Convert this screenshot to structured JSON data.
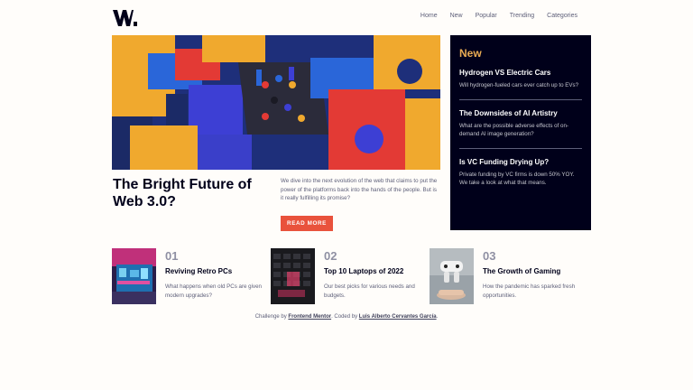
{
  "brand": {
    "logo_alt": "W."
  },
  "nav": {
    "items": [
      "Home",
      "New",
      "Popular",
      "Trending",
      "Categories"
    ]
  },
  "hero": {
    "title": "The Bright Future of Web 3.0?",
    "description": "We dive into the next evolution of the web that claims to put the power of the platforms back into the hands of the people. But is it really fulfilling its promise?",
    "button_label": "READ MORE"
  },
  "new_section": {
    "heading": "New",
    "items": [
      {
        "title": "Hydrogen VS Electric Cars",
        "description": "Will hydrogen-fueled cars ever catch up to EVs?"
      },
      {
        "title": "The Downsides of AI Artistry",
        "description": "What are the possible adverse effects of on-demand AI image generation?"
      },
      {
        "title": "Is VC Funding Drying Up?",
        "description": "Private funding by VC firms is down 50% YOY. We take a look at what that means."
      }
    ]
  },
  "cards": [
    {
      "number": "01",
      "title": "Reviving Retro PCs",
      "description": "What happens when old PCs are given modern upgrades?"
    },
    {
      "number": "02",
      "title": "Top 10 Laptops of 2022",
      "description": "Our best picks for various needs and budgets."
    },
    {
      "number": "03",
      "title": "The Growth of Gaming",
      "description": "How the pandemic has sparked fresh opportunities."
    }
  ],
  "footer": {
    "prefix": "Challenge by",
    "link1": "Frontend Mentor",
    "middle": ". Coded by",
    "link2": "Luis Alberto Cervantes García",
    "suffix": "."
  },
  "colors": {
    "accent": "#e9523c",
    "dark": "#00001a",
    "gold": "#e9ab53",
    "muted": "#5d5f79"
  }
}
